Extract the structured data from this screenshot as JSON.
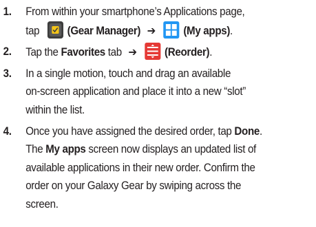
{
  "steps": [
    {
      "number": "1.",
      "line1": "From within your smartphone’s Applications page,",
      "line2_prefix": "tap",
      "icon1": "gear-manager-icon",
      "icon1_label": "(Gear Manager)",
      "arrow": "➔",
      "icon2": "my-apps-icon",
      "icon2_label": "(My apps)",
      "line2_suffix": "."
    },
    {
      "number": "2.",
      "prefix": "Tap the",
      "tab": "Favorites",
      "mid": "tab",
      "arrow": "➔",
      "icon": "reorder-icon",
      "icon_label": "(Reorder)",
      "suffix": "."
    },
    {
      "number": "3.",
      "lines": [
        "In a single motion, touch and drag an available",
        "on-screen application and place it into a new “slot”",
        "within the list."
      ]
    },
    {
      "number": "4.",
      "l1_prefix": "Once you have assigned the desired order, tap",
      "l1_bold": "Done",
      "l1_suffix": ".",
      "l2_prefix": "The",
      "l2_bold": "My apps",
      "l2_suffix": "screen now displays an updated list of",
      "lines": [
        "available applications in their new order. Confirm the",
        "order on your Galaxy Gear by swiping across the",
        "screen."
      ]
    }
  ],
  "colors": {
    "text": "#231f20",
    "gear_bg": "#3d3d3d",
    "gear_face": "#f5c518",
    "apps_blue": "#2196f3",
    "reorder_red": "#e53935"
  }
}
